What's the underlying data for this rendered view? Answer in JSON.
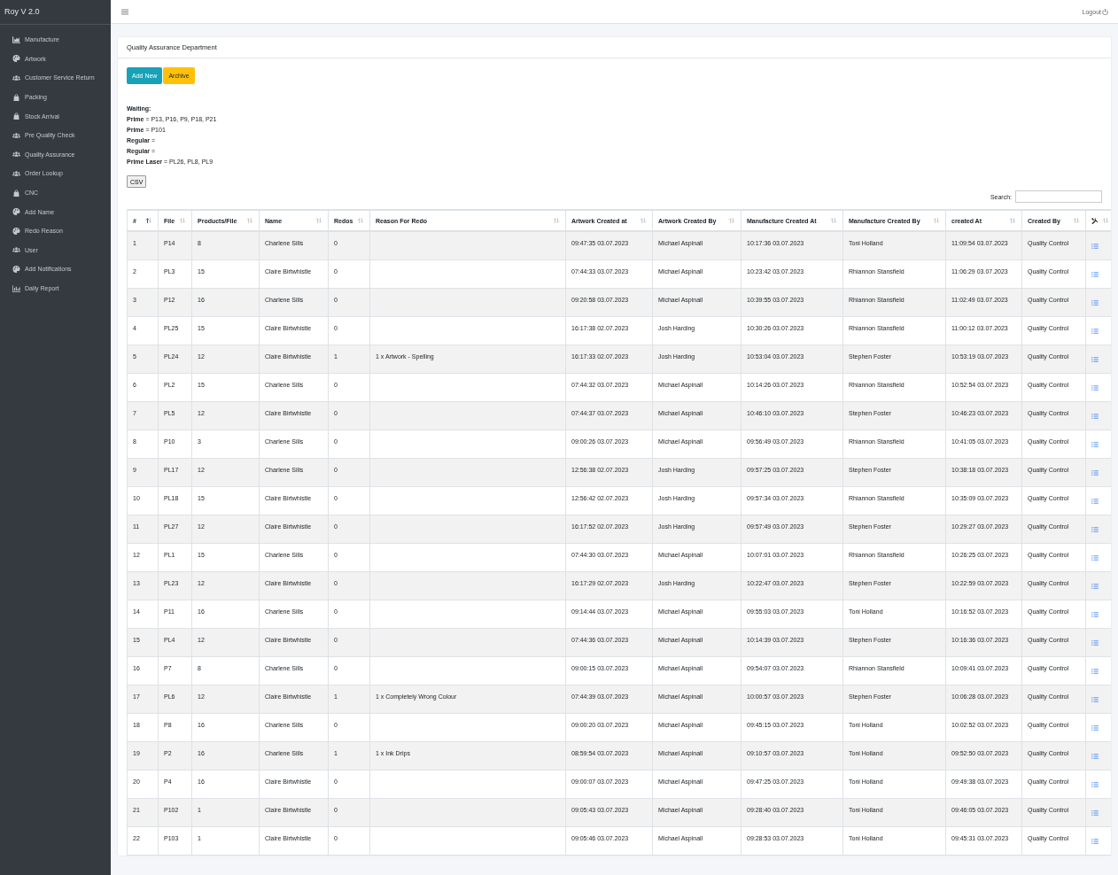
{
  "brand": "Roy V 2.0",
  "sidebar": {
    "items": [
      {
        "label": "Manufacture"
      },
      {
        "label": "Artwork"
      },
      {
        "label": "Customer Service Return"
      },
      {
        "label": "Packing"
      },
      {
        "label": "Stock Arrival"
      },
      {
        "label": "Pre Quality Check"
      },
      {
        "label": "Quality Assurance"
      },
      {
        "label": "Order Lookup"
      },
      {
        "label": "CNC"
      },
      {
        "label": "Add Name"
      },
      {
        "label": "Redo Reason"
      },
      {
        "label": "User"
      },
      {
        "label": "Add Notifications"
      },
      {
        "label": "Daily Report"
      }
    ]
  },
  "navbar": {
    "logout": "Logout"
  },
  "card": {
    "title": "Quality Assurance Department",
    "buttons": [
      {
        "label": "Add New",
        "kind": "primary"
      },
      {
        "label": "Archive",
        "kind": "warning"
      }
    ],
    "waiting": [
      "**Waiting:**",
      "**Prime** = P13, P16, P9, P18, P21",
      "**Prime** = P101",
      "**Regular** =",
      "**Regular** =",
      "**Prime Laser** = PL26, PL8, PL9"
    ],
    "csv": "CSV",
    "search": {
      "label": "Search:"
    }
  },
  "table": {
    "columns": [
      {
        "label": "#",
        "sorted": true
      },
      {
        "label": "File",
        "sorted": false
      },
      {
        "label": "Products/File",
        "sorted": false
      },
      {
        "label": "Name",
        "sorted": false
      },
      {
        "label": "Redos",
        "sorted": false
      },
      {
        "label": "Reason For Redo",
        "sorted": false
      },
      {
        "label": "Artwork Created at",
        "sorted": false
      },
      {
        "label": "Artwork Created By",
        "sorted": false
      },
      {
        "label": "Manufacture Created At",
        "sorted": false
      },
      {
        "label": "Manufacture Created By",
        "sorted": false
      },
      {
        "label": "created At",
        "sorted": false
      },
      {
        "label": "Created By",
        "sorted": false
      },
      {
        "kind": "actions",
        "sorted": false
      }
    ],
    "rows": [
      [
        "1",
        "P14",
        "8",
        "Charlene Sills",
        "0",
        null,
        "09:47:35 03.07.2023",
        "Michael Aspinall",
        "10:17:36 03.07.2023",
        "Toni Holland",
        "11:09:54 03.07.2023",
        "Quality Control"
      ],
      [
        "2",
        "PL3",
        "15",
        "Claire Birtwhistle",
        "0",
        null,
        "07:44:33 03.07.2023",
        "Michael Aspinall",
        "10:23:42 03.07.2023",
        "Rhiannon Stansfield",
        "11:06:29 03.07.2023",
        "Quality Control"
      ],
      [
        "3",
        "P12",
        "16",
        "Charlene Sills",
        "0",
        null,
        "09:20:58 03.07.2023",
        "Michael Aspinall",
        "10:39:55 03.07.2023",
        "Rhiannon Stansfield",
        "11:02:49 03.07.2023",
        "Quality Control"
      ],
      [
        "4",
        "PL25",
        "15",
        "Claire Birtwhistle",
        "0",
        null,
        "16:17:38 02.07.2023",
        "Josh Harding",
        "10:30:26 03.07.2023",
        "Rhiannon Stansfield",
        "11:00:12 03.07.2023",
        "Quality Control"
      ],
      [
        "5",
        "PL24",
        "12",
        "Claire Birtwhistle",
        "1",
        "1 x Artwork - Spelling",
        "16:17:33 02.07.2023",
        "Josh Harding",
        "10:53:04 03.07.2023",
        "Stephen Foster",
        "10:53:19 03.07.2023",
        "Quality Control"
      ],
      [
        "6",
        "PL2",
        "15",
        "Charlene Sills",
        "0",
        null,
        "07:44:32 03.07.2023",
        "Michael Aspinall",
        "10:14:26 03.07.2023",
        "Rhiannon Stansfield",
        "10:52:54 03.07.2023",
        "Quality Control"
      ],
      [
        "7",
        "PL5",
        "12",
        "Claire Birtwhistle",
        "0",
        null,
        "07:44:37 03.07.2023",
        "Michael Aspinall",
        "10:46:10 03.07.2023",
        "Stephen Foster",
        "10:46:23 03.07.2023",
        "Quality Control"
      ],
      [
        "8",
        "P10",
        "3",
        "Charlene Sills",
        "0",
        null,
        "09:00:26 03.07.2023",
        "Michael Aspinall",
        "09:56:49 03.07.2023",
        "Rhiannon Stansfield",
        "10:41:05 03.07.2023",
        "Quality Control"
      ],
      [
        "9",
        "PL17",
        "12",
        "Charlene Sills",
        "0",
        null,
        "12:56:38 02.07.2023",
        "Josh Harding",
        "09:57:25 03.07.2023",
        "Stephen Foster",
        "10:38:18 03.07.2023",
        "Quality Control"
      ],
      [
        "10",
        "PL18",
        "15",
        "Claire Birtwhistle",
        "0",
        null,
        "12:56:42 02.07.2023",
        "Josh Harding",
        "09:57:34 03.07.2023",
        "Rhiannon Stansfield",
        "10:35:09 03.07.2023",
        "Quality Control"
      ],
      [
        "11",
        "PL27",
        "12",
        "Claire Birtwhistle",
        "0",
        null,
        "16:17:52 02.07.2023",
        "Josh Harding",
        "09:57:49 03.07.2023",
        "Stephen Foster",
        "10:29:27 03.07.2023",
        "Quality Control"
      ],
      [
        "12",
        "PL1",
        "15",
        "Charlene Sills",
        "0",
        null,
        "07:44:30 03.07.2023",
        "Michael Aspinall",
        "10:07:01 03.07.2023",
        "Rhiannon Stansfield",
        "10:26:25 03.07.2023",
        "Quality Control"
      ],
      [
        "13",
        "PL23",
        "12",
        "Claire Birtwhistle",
        "0",
        null,
        "16:17:29 02.07.2023",
        "Josh Harding",
        "10:22:47 03.07.2023",
        "Stephen Foster",
        "10:22:59 03.07.2023",
        "Quality Control"
      ],
      [
        "14",
        "P11",
        "16",
        "Charlene Sills",
        "0",
        null,
        "09:14:44 03.07.2023",
        "Michael Aspinall",
        "09:55:03 03.07.2023",
        "Toni Holland",
        "10:16:52 03.07.2023",
        "Quality Control"
      ],
      [
        "15",
        "PL4",
        "12",
        "Claire Birtwhistle",
        "0",
        null,
        "07:44:36 03.07.2023",
        "Michael Aspinall",
        "10:14:39 03.07.2023",
        "Stephen Foster",
        "10:16:36 03.07.2023",
        "Quality Control"
      ],
      [
        "16",
        "P7",
        "8",
        "Charlene Sills",
        "0",
        null,
        "09:00:15 03.07.2023",
        "Michael Aspinall",
        "09:54:07 03.07.2023",
        "Rhiannon Stansfield",
        "10:09:41 03.07.2023",
        "Quality Control"
      ],
      [
        "17",
        "PL6",
        "12",
        "Claire Birtwhistle",
        "1",
        "1 x Completely Wrong Colour",
        "07:44:39 03.07.2023",
        "Michael Aspinall",
        "10:00:57 03.07.2023",
        "Stephen Foster",
        "10:06:28 03.07.2023",
        "Quality Control"
      ],
      [
        "18",
        "P8",
        "16",
        "Charlene Sills",
        "0",
        null,
        "09:00:20 03.07.2023",
        "Michael Aspinall",
        "09:45:15 03.07.2023",
        "Toni Holland",
        "10:02:52 03.07.2023",
        "Quality Control"
      ],
      [
        "19",
        "P2",
        "16",
        "Charlene Sills",
        "1",
        "1 x Ink Drips",
        "08:59:54 03.07.2023",
        "Michael Aspinall",
        "09:10:57 03.07.2023",
        "Toni Holland",
        "09:52:50 03.07.2023",
        "Quality Control"
      ],
      [
        "20",
        "P4",
        "16",
        "Claire Birtwhistle",
        "0",
        null,
        "09:00:07 03.07.2023",
        "Michael Aspinall",
        "09:47:25 03.07.2023",
        "Toni Holland",
        "09:49:38 03.07.2023",
        "Quality Control"
      ],
      [
        "21",
        "P102",
        "1",
        "Claire Birtwhistle",
        "0",
        null,
        "09:05:43 03.07.2023",
        "Michael Aspinall",
        "09:28:40 03.07.2023",
        "Toni Holland",
        "09:46:05 03.07.2023",
        "Quality Control"
      ],
      [
        "22",
        "P103",
        "1",
        "Claire Birtwhistle",
        "0",
        null,
        "09:05:46 03.07.2023",
        "Michael Aspinall",
        "09:28:53 03.07.2023",
        "Toni Holland",
        "09:45:31 03.07.2023",
        "Quality Control"
      ]
    ]
  }
}
